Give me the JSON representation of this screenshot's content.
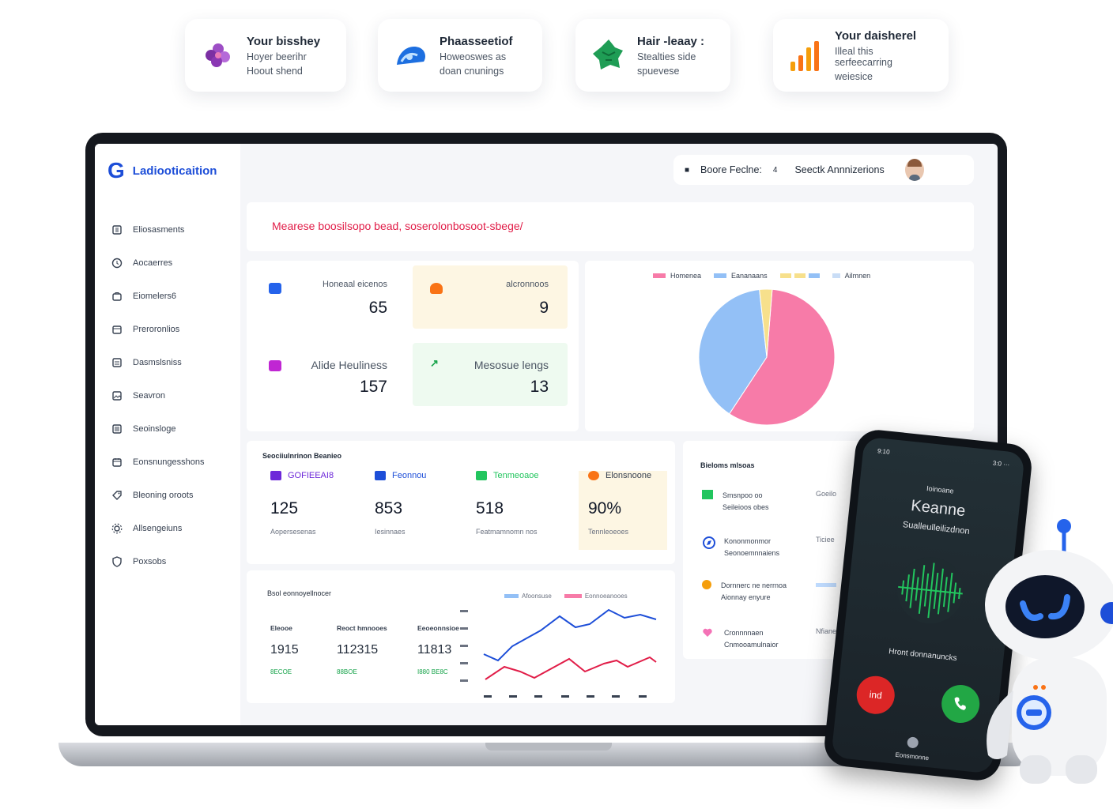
{
  "feature_cards": [
    {
      "title": "Your bisshey",
      "line1": "Hoyer beerihr",
      "line2": "Hoout shend",
      "icon": "purple-flower-icon"
    },
    {
      "title": "Phaasseetiof",
      "line1": "Howeoswes as",
      "line2": "doan cnunings",
      "icon": "blue-wave-icon"
    },
    {
      "title": "Hair -leaay :",
      "line1": "Stealties side",
      "line2": "spuevese",
      "icon": "green-map-icon"
    },
    {
      "title": "Your daisherel",
      "line1": "Illeal this serfeecarring",
      "line2": "weiesice",
      "icon": "orange-bars-icon"
    }
  ],
  "app": {
    "logo_letter": "G",
    "name": "Ladiooticaition"
  },
  "sidebar": {
    "items": [
      {
        "label": "Eliosasments"
      },
      {
        "label": "Aocaerres"
      },
      {
        "label": "Eiomelers6"
      },
      {
        "label": "Preroronlios"
      },
      {
        "label": "Dasmslsniss"
      },
      {
        "label": "Seavron"
      },
      {
        "label": "Seoinsloge"
      },
      {
        "label": "Eonsnungesshons"
      },
      {
        "label": "Bleoning oroots"
      },
      {
        "label": "Allsengeiuns"
      },
      {
        "label": "Poxsobs"
      }
    ]
  },
  "topbar": {
    "label": "Boore Feclne:",
    "value": "4",
    "search": "Seectk Annnizerions"
  },
  "banner": {
    "text": "Mearese boosilsopo bead, soserolonbosoot-sbege/"
  },
  "stats": [
    {
      "label": "Honeaal eicenos",
      "value": "65"
    },
    {
      "label": "alcronnoos",
      "value": "9"
    },
    {
      "label": "Alide Heuliness",
      "value": "157"
    },
    {
      "label": "Mesosue lengs",
      "value": "13"
    }
  ],
  "pie": {
    "legend": [
      "Homenea",
      "Eananaans",
      "",
      "Ailmnen"
    ],
    "colors": [
      "#f77ba8",
      "#93c0f6",
      "#f7e08c",
      "#c9ddf6"
    ]
  },
  "chart_data": {
    "type": "pie",
    "categories": [
      "Homenea",
      "Eananaans",
      "",
      "Ailmnen"
    ],
    "values": [
      58,
      39,
      3,
      0
    ],
    "title": ""
  },
  "summary": {
    "title": "Seociiulnrinon Beanieo",
    "metrics": [
      {
        "label": "GOFIEEAI8",
        "value": "125",
        "sub": "Aopersesenas",
        "color": "#7c3aed"
      },
      {
        "label": "Feonnou",
        "value": "853",
        "sub": "Iesinnaes",
        "color": "#1d4ed8"
      },
      {
        "label": "Tenmeoaoe",
        "value": "518",
        "sub": "Featmamnomn nos",
        "color": "#22c55e"
      },
      {
        "label": "Elonsnoone",
        "value": "90%",
        "sub": "Tennleoeoes",
        "color": "#f97316"
      }
    ]
  },
  "right_list": {
    "title": "Bieloms mlsoas",
    "items": [
      {
        "l1": "Smsnpoo  oo",
        "l2": "Seileioos obes",
        "r": "Goeilo"
      },
      {
        "l1": "Kononmonmor",
        "l2": "Seonoemnnaiens",
        "r": "Ticiee"
      },
      {
        "l1": "Dornnerc ne nerrnoa",
        "l2": "Aionnay enyure",
        "r": ""
      },
      {
        "l1": "Cronnnnaen",
        "l2": "Cnmooamulnaior",
        "r": "Nfiane"
      }
    ]
  },
  "trends": {
    "title": "Bsol eonnoyellnocer",
    "legend": [
      "Afoonsuse",
      "Eonnoeanooes"
    ],
    "cols": [
      {
        "head": "Eleooe",
        "value": "1915",
        "sub": "8ECOE"
      },
      {
        "head": "Reoct hmnooes",
        "value": "112315",
        "sub": "88BOE"
      },
      {
        "head": "Eeoeonnsioe",
        "value": "11813",
        "sub": "I880 BE8C"
      }
    ]
  },
  "phone": {
    "time": "9:10",
    "status": "3:0 ···",
    "caller_label": "Ioinoane",
    "caller_name": "Keanne",
    "caller_sub": "Sualleulleilizdnon",
    "status_line": "Hront donnanuncks",
    "decline_label": "ind",
    "footer": "Eonsmonne"
  }
}
